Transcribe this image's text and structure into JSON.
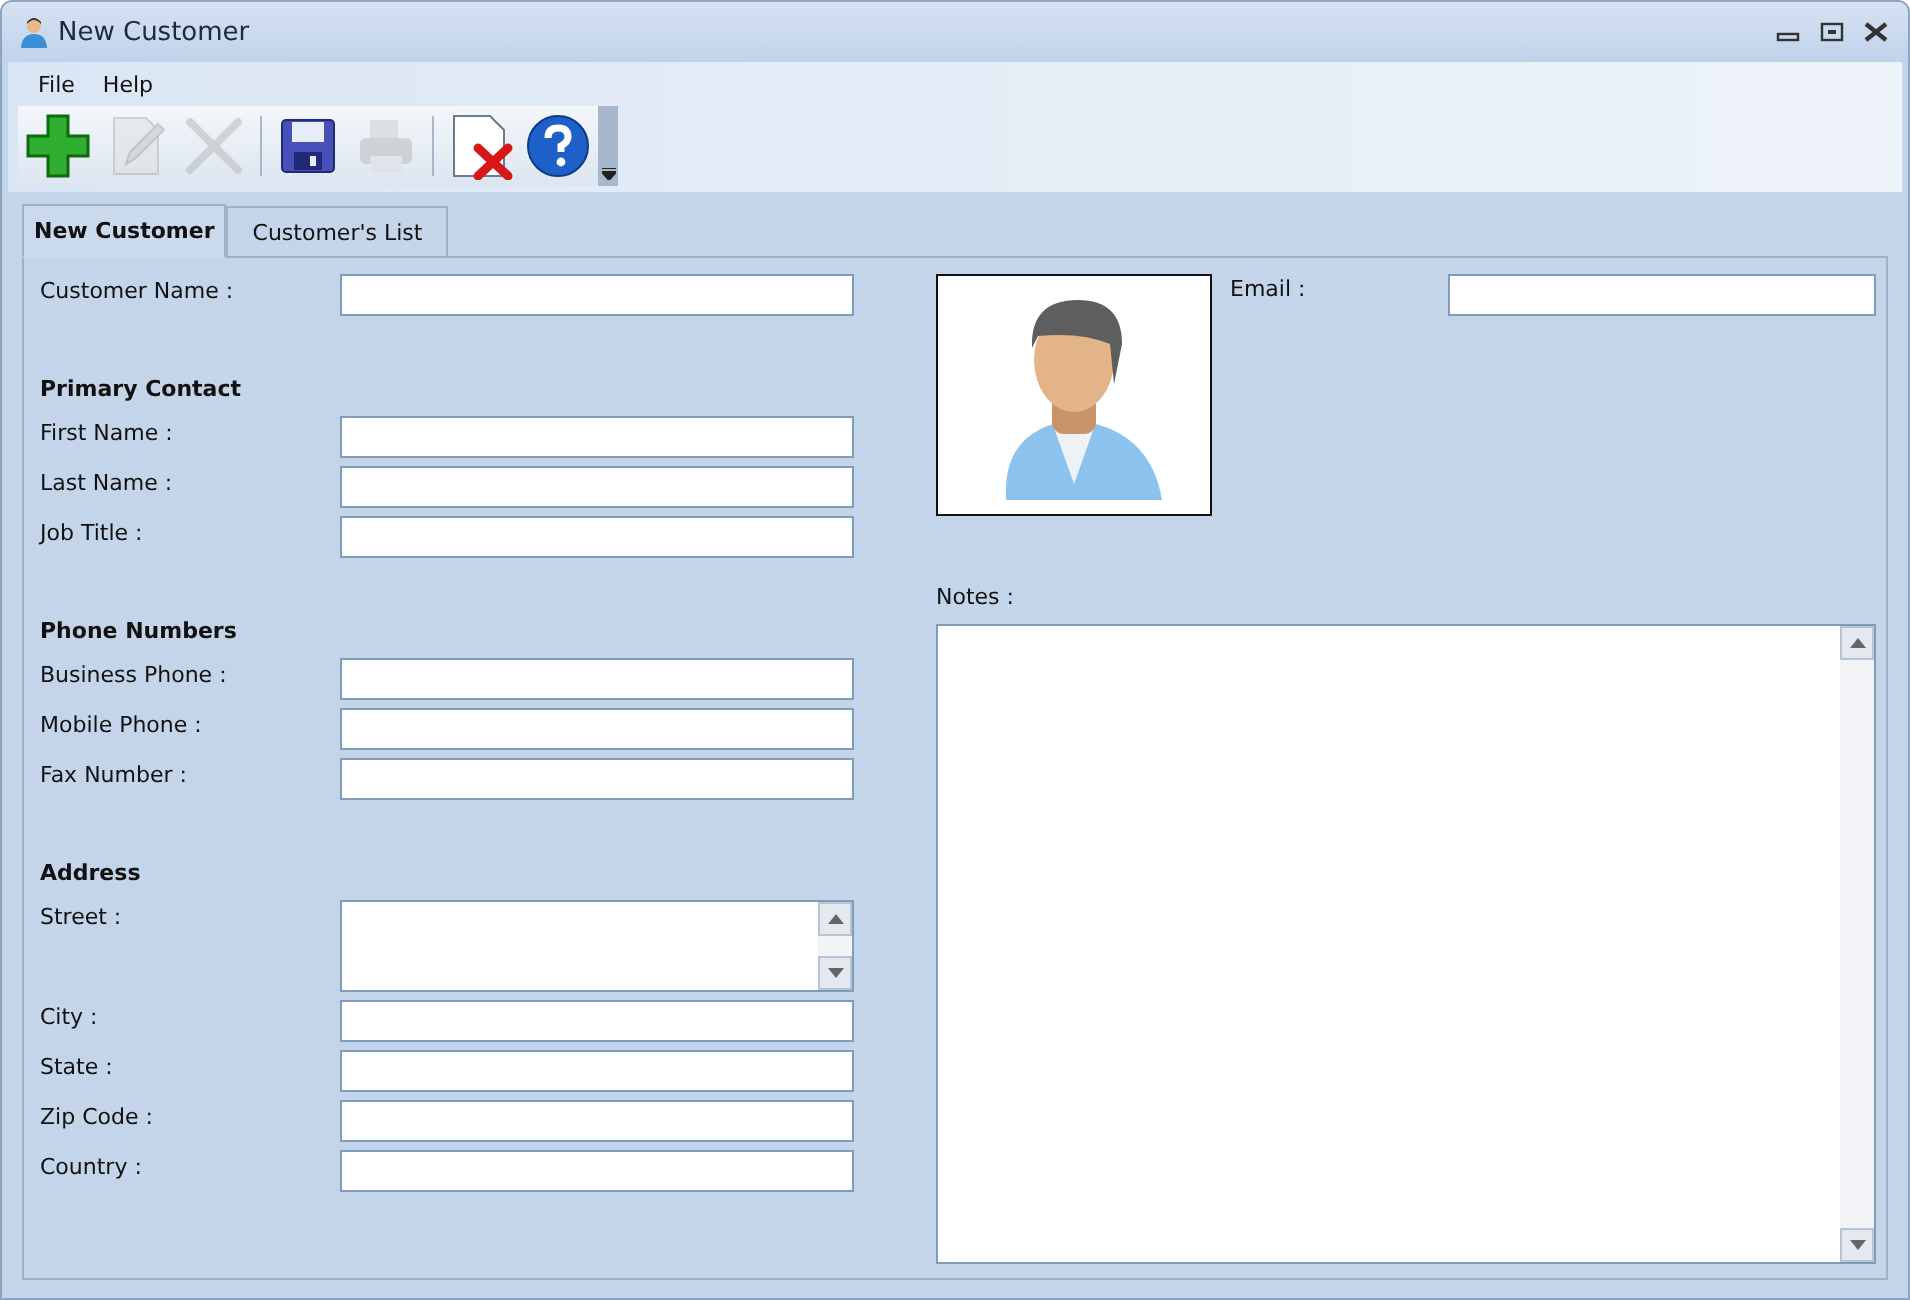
{
  "window": {
    "title": "New Customer"
  },
  "menu": [
    "File",
    "Help"
  ],
  "toolbar": [
    {
      "kind": "add",
      "disabled": false
    },
    {
      "kind": "edit",
      "disabled": true
    },
    {
      "kind": "delete",
      "disabled": true
    },
    {
      "kind": "separator"
    },
    {
      "kind": "save",
      "disabled": false
    },
    {
      "kind": "print",
      "disabled": true
    },
    {
      "kind": "separator"
    },
    {
      "kind": "close-document",
      "disabled": false
    },
    {
      "kind": "help",
      "disabled": false
    }
  ],
  "tabs": [
    {
      "label": "New Customer",
      "selected": true
    },
    {
      "label": "Customer's List",
      "selected": false
    }
  ],
  "groups": [
    {
      "fields": [
        {
          "label": "Customer Name :",
          "kind": "text"
        }
      ]
    },
    {
      "heading": "Primary Contact",
      "fields": [
        {
          "label": "First Name :",
          "kind": "text"
        },
        {
          "label": "Last Name :",
          "kind": "text"
        },
        {
          "label": "Job Title :",
          "kind": "text"
        }
      ]
    },
    {
      "heading": "Phone Numbers",
      "fields": [
        {
          "label": "Business Phone :",
          "kind": "text"
        },
        {
          "label": "Mobile Phone :",
          "kind": "text"
        },
        {
          "label": "Fax Number :",
          "kind": "text"
        }
      ]
    },
    {
      "heading": "Address",
      "fields": [
        {
          "label": "Street :",
          "kind": "textarea"
        },
        {
          "label": "City :",
          "kind": "text"
        },
        {
          "label": "State :",
          "kind": "text"
        },
        {
          "label": "Zip Code :",
          "kind": "text"
        },
        {
          "label": "Country :",
          "kind": "text"
        }
      ]
    }
  ],
  "email": {
    "label": "Email :"
  },
  "notes": {
    "label": "Notes :"
  }
}
